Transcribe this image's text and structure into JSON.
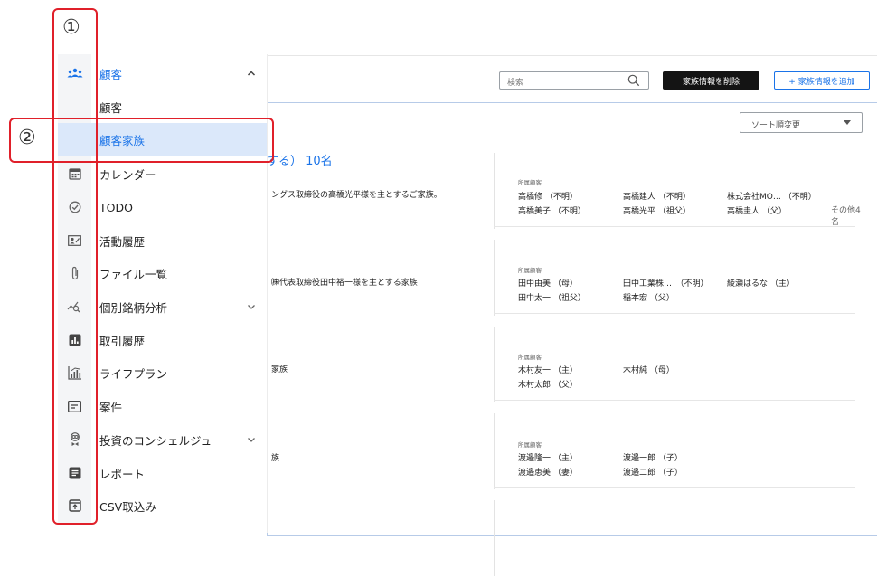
{
  "annotations": {
    "marker1": "①",
    "marker2": "②"
  },
  "toolbar": {
    "search_placeholder": "検索",
    "delete_label": "家族情報を削除",
    "add_label": "+ 家族情報を追加"
  },
  "sort": {
    "label": "ソート順変更"
  },
  "family_count": "する） 10名",
  "members_label": "所属顧客",
  "families": [
    {
      "desc": "ングス取締役の高橋光平様を主とするご家族。",
      "members": [
        "高橋修 （不明）",
        "高橋建人 （不明）",
        "株式会社MO… （不明）",
        "高橋美子 （不明）",
        "高橋光平 （祖父）",
        "高橋圭人 （父）"
      ],
      "other": "その他4名"
    },
    {
      "desc": "㈱代表取締役田中裕一様を主とする家族",
      "members": [
        "田中由美 （母）",
        "田中工業株…　（不明）",
        "綾瀬はるな （主）",
        "田中太一 （祖父）",
        "稲本宏 （父）"
      ]
    },
    {
      "desc": "家族",
      "members": [
        "木村友一 （主）",
        "木村純 （母）",
        "木村太郎 （父）"
      ]
    },
    {
      "desc": "族",
      "members": [
        "渡邉隆一 （主）",
        "渡邉一郎 （子）",
        "渡邉恵美 （妻）",
        "渡邉二郎 （子）"
      ]
    }
  ],
  "sidebar": {
    "items": [
      {
        "label": "顧客",
        "icon": "customers-icon"
      },
      {
        "label": "顧客"
      },
      {
        "label": "顧客家族"
      },
      {
        "label": "カレンダー",
        "icon": "calendar-icon"
      },
      {
        "label": "TODO",
        "icon": "check-circle-icon"
      },
      {
        "label": "活動履歴",
        "icon": "activity-icon"
      },
      {
        "label": "ファイル一覧",
        "icon": "paperclip-icon"
      },
      {
        "label": "個別銘柄分析",
        "icon": "stock-analysis-icon"
      },
      {
        "label": "取引履歴",
        "icon": "trade-history-icon"
      },
      {
        "label": "ライフプラン",
        "icon": "lifeplan-icon"
      },
      {
        "label": "案件",
        "icon": "case-icon"
      },
      {
        "label": "投資のコンシェルジュ",
        "icon": "concierge-icon"
      },
      {
        "label": "レポート",
        "icon": "report-icon"
      },
      {
        "label": "CSV取込み",
        "icon": "csv-import-icon"
      }
    ]
  },
  "colors": {
    "accent": "#1a73e8",
    "active_bg": "#dbe8fa",
    "annotation": "#e0202a"
  }
}
